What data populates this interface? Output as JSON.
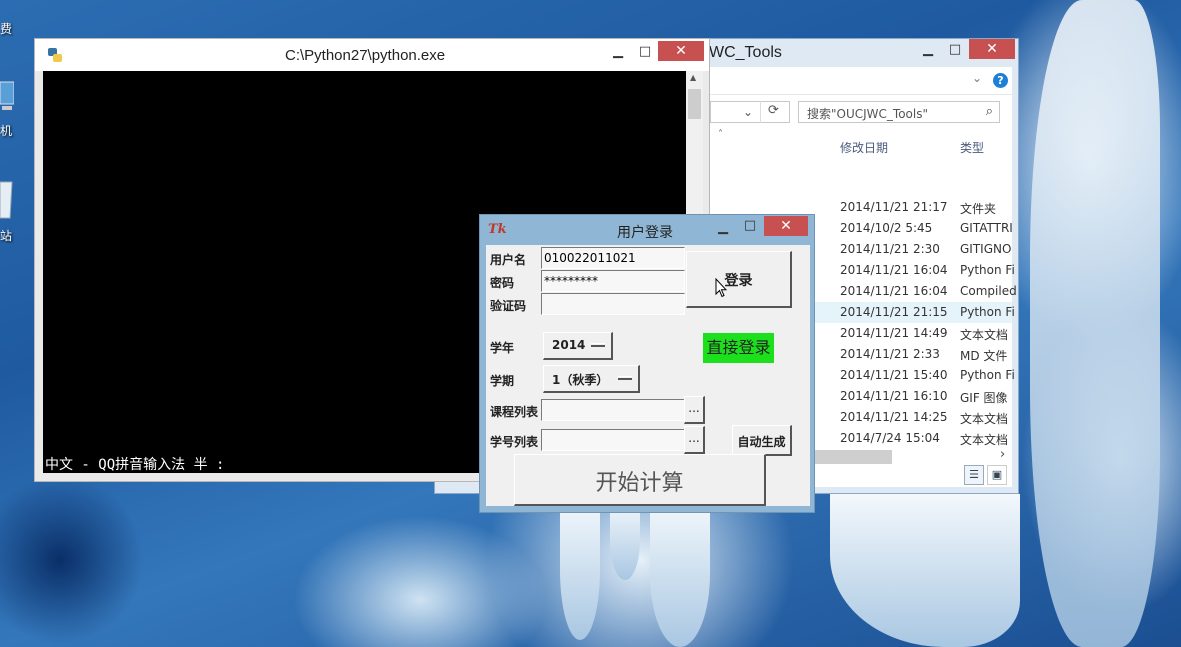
{
  "desktop": {
    "icons": [
      {
        "label": "机",
        "icon": "computer-icon"
      },
      {
        "label": "站",
        "icon": "recycle-bin-icon"
      }
    ],
    "left_edge_label": "费"
  },
  "explorer": {
    "title": "WC_Tools",
    "search_placeholder": "搜索\"OUCJWC_Tools\"",
    "columns": {
      "date": "修改日期",
      "type": "类型",
      "sort_arrow": "˄"
    },
    "files": [
      {
        "date": "2014/11/21 21:17",
        "type": "文件夹"
      },
      {
        "date": "2014/10/2 5:45",
        "type": "GITATTRI"
      },
      {
        "date": "2014/11/21 2:30",
        "type": "GITIGNO"
      },
      {
        "date": "2014/11/21 16:04",
        "type": "Python Fi"
      },
      {
        "date": "2014/11/21 16:04",
        "type": "Compiled"
      },
      {
        "date": "2014/11/21 21:15",
        "type": "Python Fi"
      },
      {
        "date": "2014/11/21 14:49",
        "type": "文本文档"
      },
      {
        "date": "2014/11/21 2:33",
        "type": "MD 文件"
      },
      {
        "date": "2014/11/21 15:40",
        "type": "Python Fi"
      },
      {
        "date": "2014/11/21 16:10",
        "type": "GIF 图像"
      },
      {
        "date": "2014/11/21 14:25",
        "type": "文本文档"
      },
      {
        "date": "2014/7/24 15:04",
        "type": "文本文档"
      }
    ],
    "selected_row": 5,
    "scroll_right": "›"
  },
  "console": {
    "title": "C:\\Python27\\python.exe",
    "ime_status": "中文 - QQ拼音输入法 半 :",
    "up_arrow": "▲"
  },
  "login": {
    "title": "用户登录",
    "tk_logo": "Tk",
    "labels": {
      "username": "用户名",
      "password": "密码",
      "captcha": "验证码",
      "year": "学年",
      "term": "学期",
      "course_list": "课程列表",
      "student_list": "学号列表"
    },
    "values": {
      "username": "010022011021",
      "password": "*********",
      "captcha": "",
      "year": "2014",
      "term": "1（秋季）",
      "course_list": "",
      "student_list": ""
    },
    "buttons": {
      "login": "登录",
      "direct_login": "直接登录",
      "browse": "...",
      "auto_generate": "自动生成",
      "start": "开始计算"
    },
    "direct_login_color": "#1de01d"
  },
  "window_controls": {
    "minimize": "▁",
    "maximize": "□",
    "close": "✕"
  }
}
